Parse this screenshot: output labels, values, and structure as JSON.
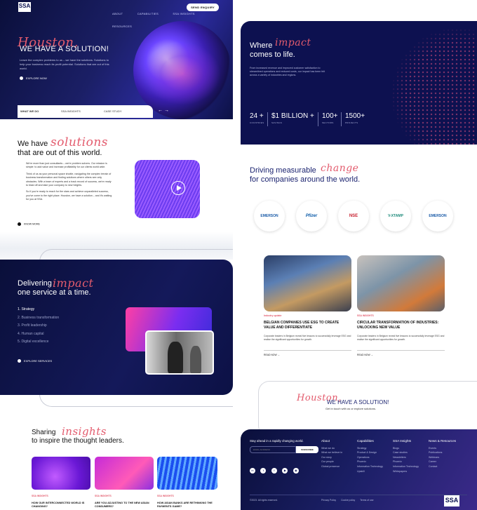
{
  "brand": {
    "logo_text": "SSA",
    "logo_sub": "CONSULTING GROUP"
  },
  "nav": {
    "items": [
      "ABOUT",
      "CAPABILITIES",
      "SSA INSIGHTS",
      "RESOURCES"
    ],
    "cta": "SEND ENQUIRY"
  },
  "hero": {
    "script": "Houston,",
    "title": "WE HAVE A SOLUTION!",
    "body": "Leave the complex problems to us – we have the solutions. Solutions to help your business reach its profit potential. Solutions that are out of this world.",
    "cta": "EXPLORE NOW",
    "tabs": [
      "WHAT WE DO",
      "SSA INSIGHTS",
      "CASE STUDY"
    ],
    "arrows": "←  →"
  },
  "solutions": {
    "script": "solutions",
    "title_a": "We have",
    "title_b": "that are out of this world.",
    "p1": "We're more than just consultants – we're problem solvers. Our mission is simple: to add value and increase profitability for our clients world wide.",
    "p2": "Think of us as your personal space shuttle, navigating the complex terrain of business transformation and finding solutions where others see only obstacles. With a team of experts and a track record of success, we're ready to blast off and take your company to new heights.",
    "p3": "So if you're ready to reach for the stars and achieve unparalleled success, you've come to the right place. Houston, we have a solution – and it's waiting for you at SSA.",
    "cta": "KNOW MORE"
  },
  "services": {
    "script": "impact",
    "title_a": "Delivering",
    "title_b": "one service at a time.",
    "items": [
      "1. Strategy",
      "2. Business transformation",
      "3. Profit leadership",
      "4. Human capital",
      "5. Digital excellence"
    ],
    "cta": "EXPLORE SERVICES"
  },
  "insights": {
    "script": "insights",
    "title_a": "Sharing",
    "title_b": "to inspire the thought leaders.",
    "cards": [
      {
        "tag": "SSA INSIGHTS",
        "title": "HOW OUR INTERCONNECTED WORLD IS CHANGING?"
      },
      {
        "tag": "SSA INSIGHTS",
        "title": "ARE YOU ADJUSTING TO THE NEW ASIAN CONSUMERS?"
      },
      {
        "tag": "SSA INSIGHTS",
        "title": "HOW ASIAN BANKS ARE RETHINKING THE PAYMENTS GAME?"
      }
    ]
  },
  "impact": {
    "script": "impact",
    "title_a": "Where",
    "title_b": "comes to life.",
    "body": "From increased revenue and improved customer satisfaction to streamlined operations and reduced costs, our impact has been felt across a variety of industries and regions.",
    "stats": [
      {
        "value": "24 +",
        "label": "COUNTRIES"
      },
      {
        "value": "$1 BILLION +",
        "label": "SAVINGS"
      },
      {
        "value": "100+",
        "label": "SECTORS"
      },
      {
        "value": "1500+",
        "label": "PROJECTS"
      }
    ]
  },
  "clients": {
    "script": "change",
    "title_a": "Driving measurable",
    "title_b": "for companies around the world.",
    "logos": [
      "EMERSON",
      "Pfizer",
      "NSE",
      "V-XTAMP",
      "EMERSON"
    ]
  },
  "news": [
    {
      "tag": "Industry update",
      "title": "BELGIAN COMPANIES USE ESG TO CREATE VALUE AND DIFFERENTIATE",
      "body": "Corporate leaders in Belgium reveal five lessons to successfully leverage ESG and realise the significant opportunities for growth.",
      "cta": "READ NOW"
    },
    {
      "tag": "SSA INSIGHTS",
      "title": "CIRCULAR TRANSFORMATION OF INDUSTRIES: UNLOCKING NEW VALUE",
      "body": "Corporate leaders in Belgium reveal five lessons to successfully leverage ESG and realise the significant opportunities for growth.",
      "cta": "READ NOW"
    }
  ],
  "cta_block": {
    "script": "Houston,",
    "title": "WE HAVE A SOLUTION!",
    "sub": "Get in touch with us or explore solutions."
  },
  "footer": {
    "stay": "Stay ahead in a rapidly changing world.",
    "email_placeholder": "EMAIL ADDRESS",
    "subscribe": "SUBSCRIBE",
    "social": [
      "in",
      "t",
      "f",
      "▶",
      "◉"
    ],
    "cols": [
      {
        "title": "About",
        "items": [
          "What we do",
          "What we believe in",
          "Our story",
          "Our people",
          "Global presence"
        ]
      },
      {
        "title": "Capabilities",
        "items": [
          "Strategy",
          "Product & Design",
          "Operations",
          "Phoenix",
          "Information Technology",
          "Upskill"
        ]
      },
      {
        "title": "SSA Insights",
        "items": [
          "Blogs",
          "Case studies",
          "Newsletters",
          "Phoenix",
          "Information Technology",
          "Whitepapers"
        ]
      },
      {
        "title": "News & Resources",
        "items": [
          "Events",
          "Publications",
          "Webinars",
          "Career",
          "Contact"
        ]
      }
    ],
    "copy": "©2023. All rights reserved.",
    "links": [
      "Privacy Policy",
      "Cookie policy",
      "Terms of use"
    ]
  }
}
